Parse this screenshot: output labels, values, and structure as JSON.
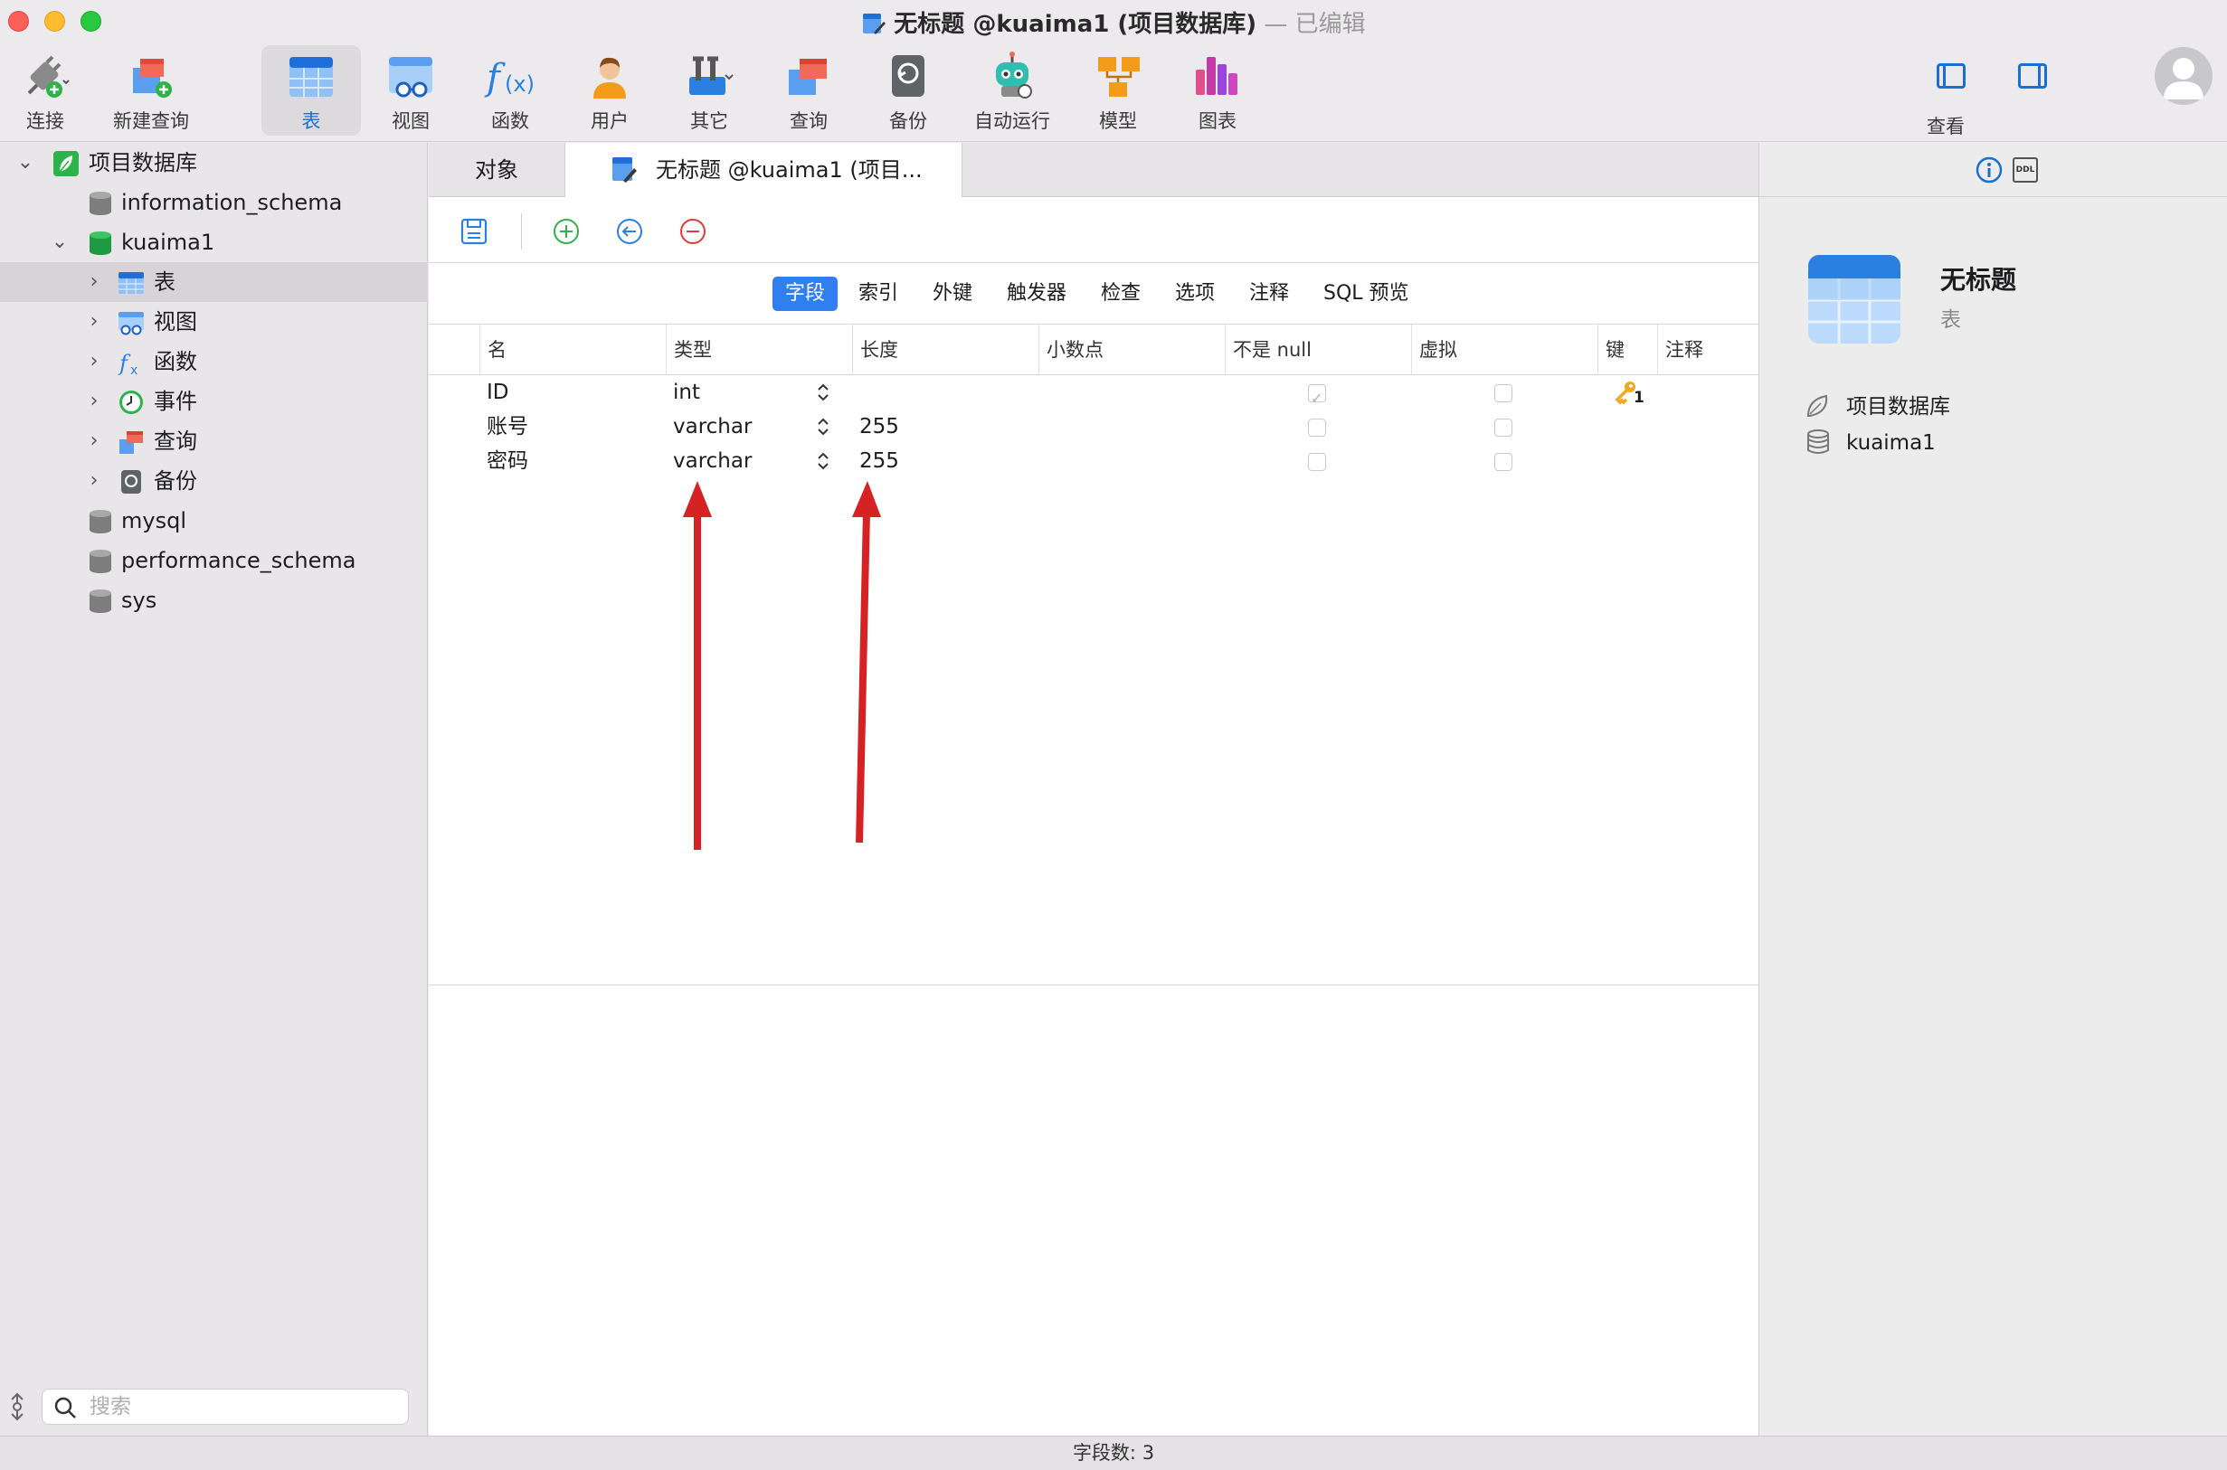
{
  "window": {
    "title": "无标题 @kuaima1 (项目数据库)",
    "edited_suffix": " — 已编辑"
  },
  "toolbar": {
    "items": [
      {
        "label": "连接",
        "icon": "plug-connect-icon"
      },
      {
        "label": "新建查询",
        "icon": "new-query-icon"
      },
      {
        "label": "表",
        "icon": "table-icon",
        "active": true
      },
      {
        "label": "视图",
        "icon": "view-glasses-icon"
      },
      {
        "label": "函数",
        "icon": "function-icon"
      },
      {
        "label": "用户",
        "icon": "user-icon"
      },
      {
        "label": "其它",
        "icon": "tools-icon"
      },
      {
        "label": "查询",
        "icon": "query-icon"
      },
      {
        "label": "备份",
        "icon": "backup-icon"
      },
      {
        "label": "自动运行",
        "icon": "robot-icon"
      },
      {
        "label": "模型",
        "icon": "model-icon"
      },
      {
        "label": "图表",
        "icon": "chart-icon"
      }
    ],
    "view_label": "查看",
    "accent": "#1a6fd6"
  },
  "sidebar": {
    "tree": [
      {
        "label": "项目数据库",
        "icon": "connection-leaf-icon",
        "expanded": true
      },
      {
        "label": "information_schema",
        "icon": "database-gray-icon"
      },
      {
        "label": "kuaima1",
        "icon": "database-green-icon",
        "expanded": true
      },
      {
        "label": "表",
        "icon": "table-icon",
        "selected": true
      },
      {
        "label": "视图",
        "icon": "view-glasses-icon"
      },
      {
        "label": "函数",
        "icon": "function-icon"
      },
      {
        "label": "事件",
        "icon": "clock-icon"
      },
      {
        "label": "查询",
        "icon": "query-icon"
      },
      {
        "label": "备份",
        "icon": "backup-icon"
      },
      {
        "label": "mysql",
        "icon": "database-gray-icon"
      },
      {
        "label": "performance_schema",
        "icon": "database-gray-icon"
      },
      {
        "label": "sys",
        "icon": "database-gray-icon"
      }
    ],
    "search": {
      "placeholder": "搜索",
      "value": ""
    }
  },
  "tabs": {
    "objects": "对象",
    "current": "无标题 @kuaima1 (项目..."
  },
  "editor": {
    "subtabs": [
      "字段",
      "索引",
      "外键",
      "触发器",
      "检查",
      "选项",
      "注释",
      "SQL 预览"
    ],
    "active_subtab": "字段",
    "columns": [
      "名",
      "类型",
      "长度",
      "小数点",
      "不是 null",
      "虚拟",
      "键",
      "注释"
    ],
    "rows": [
      {
        "name": "ID",
        "type": "int",
        "length": "",
        "decimals": "",
        "not_null": true,
        "virtual": false,
        "key": "1"
      },
      {
        "name": "账号",
        "type": "varchar",
        "length": "255",
        "decimals": "",
        "not_null": false,
        "virtual": false,
        "key": ""
      },
      {
        "name": "密码",
        "type": "varchar",
        "length": "255",
        "decimals": "",
        "not_null": false,
        "virtual": false,
        "key": ""
      }
    ]
  },
  "inspector": {
    "title": "无标题",
    "subtitle": "表",
    "connection": "项目数据库",
    "database": "kuaima1",
    "ddl_label": "DDL"
  },
  "status": {
    "field_count": "字段数: 3"
  },
  "colors": {
    "annotation_arrow": "#d62222",
    "active_subtab": "#2f7ff0",
    "key_icon": "#f0a81c"
  }
}
